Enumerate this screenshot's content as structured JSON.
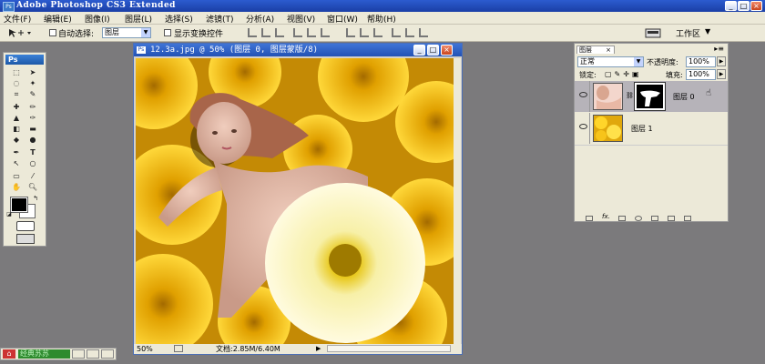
{
  "app": {
    "title": "Adobe Photoshop CS3 Extended",
    "icon": "ps-app-icon"
  },
  "window_controls": {
    "minimize": "_",
    "maximize": "□",
    "close": "×"
  },
  "menu": [
    "文件(F)",
    "编辑(E)",
    "图像(I)",
    "图层(L)",
    "选择(S)",
    "滤镜(T)",
    "分析(A)",
    "视图(V)",
    "窗口(W)",
    "帮助(H)"
  ],
  "options_bar": {
    "auto_select_label": "自动选择:",
    "auto_select_value": "图层",
    "show_transform_label": "显示变换控件",
    "workspace_label": "工作区"
  },
  "tools": {
    "logo": "Ps",
    "text_tool": "T"
  },
  "document": {
    "title": "12.3a.jpg @ 50% (图层 0, 图层蒙版/8)",
    "zoom": "50%",
    "doc_info": "文档:2.85M/6.40M"
  },
  "layers_panel": {
    "tab": "图层",
    "blend_mode": "正常",
    "opacity_label": "不透明度:",
    "opacity_value": "100%",
    "lock_label": "锁定:",
    "fill_label": "填充:",
    "fill_value": "100%",
    "layers": [
      {
        "name": "图层 0",
        "selected": true,
        "has_mask": true
      },
      {
        "name": "图层 1",
        "selected": false,
        "has_mask": false
      }
    ]
  },
  "taskbar": {
    "label": "经典苏苏"
  },
  "colors": {
    "title_blue": "#2352b5",
    "workspace_gray": "#7b7a7c",
    "panel_bg": "#ece9d8",
    "chrysanthemum_yellow": "#f2c418"
  }
}
